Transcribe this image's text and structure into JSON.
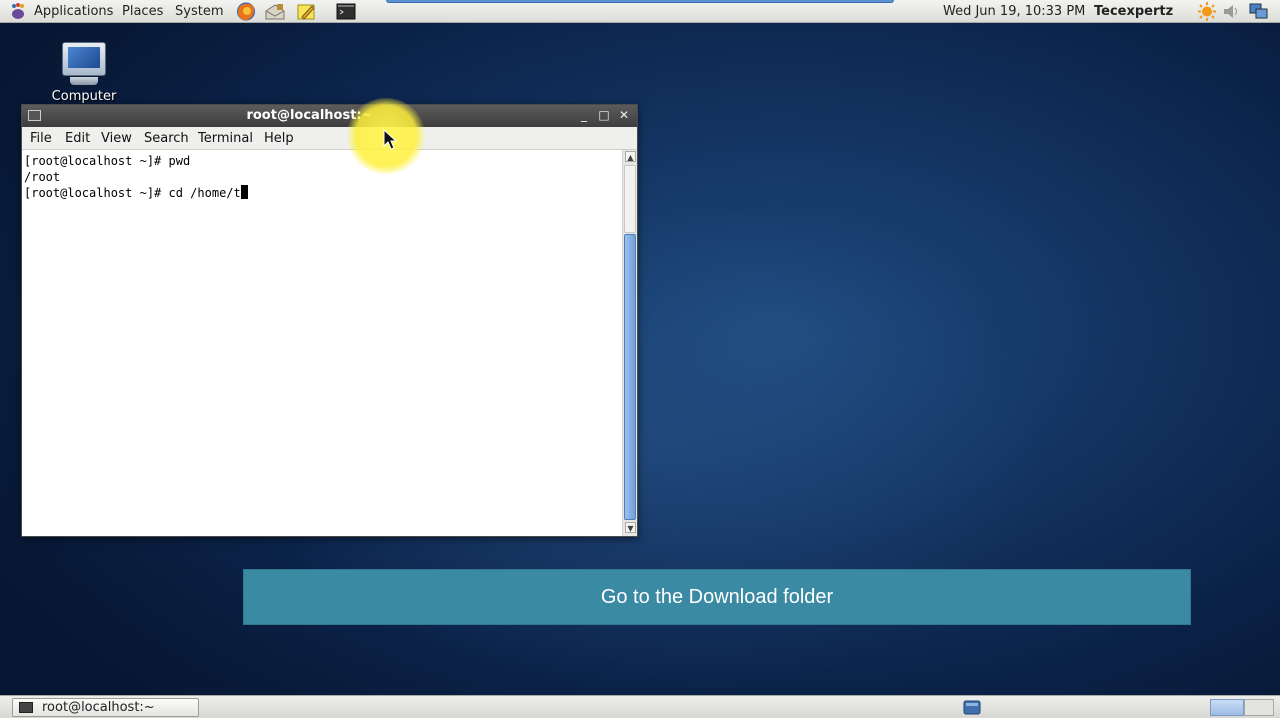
{
  "top_panel": {
    "menus": [
      "Applications",
      "Places",
      "System"
    ],
    "launchers": [
      "firefox-icon",
      "mail-icon",
      "notes-icon",
      "terminal-icon"
    ],
    "clock": "Wed Jun 19, 10:33 PM",
    "user": "Tecexpertz"
  },
  "desktop": {
    "icon_label": "Computer"
  },
  "terminal": {
    "title": "root@localhost:~",
    "menu": [
      "File",
      "Edit",
      "View",
      "Search",
      "Terminal",
      "Help"
    ],
    "lines": [
      "[root@localhost ~]# pwd",
      "/root",
      "[root@localhost ~]# cd /home/t"
    ]
  },
  "banner": {
    "text": "Go to the Download folder"
  },
  "bottom_panel": {
    "task_label": "root@localhost:~"
  },
  "colors": {
    "banner": "#3a8aa3",
    "titlebar": "#4a4a4a",
    "highlight": "#fff03c"
  }
}
